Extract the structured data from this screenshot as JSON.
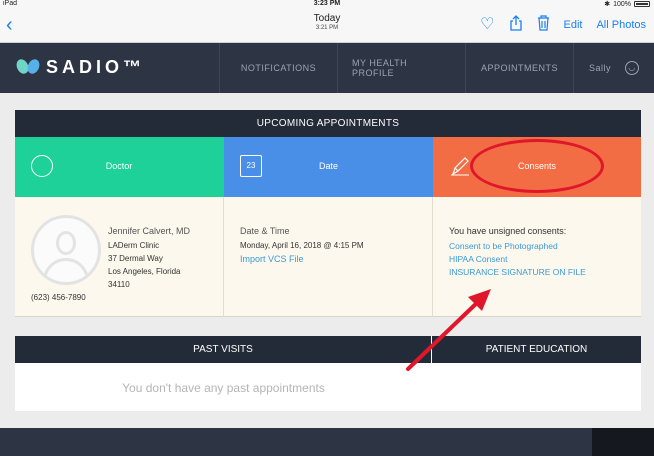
{
  "status_bar": {
    "device": "iPad",
    "time": "3:23 PM",
    "battery": "100%"
  },
  "photo_nav": {
    "title": "Today",
    "subtitle": "3:21 PM",
    "edit_label": "Edit",
    "all_photos_label": "All Photos"
  },
  "app": {
    "logo_text": "SADIO™",
    "nav": {
      "notifications": "NOTIFICATIONS",
      "health_profile": "MY HEALTH PROFILE",
      "appointments": "APPOINTMENTS",
      "user_name": "Sally"
    }
  },
  "upcoming": {
    "title": "UPCOMING APPOINTMENTS",
    "columns": {
      "doctor": "Doctor",
      "date": "Date",
      "consents": "Consents"
    },
    "calendar_day": "23",
    "doctor": {
      "name": "Jennifer Calvert, MD",
      "clinic": "LADerm Clinic",
      "street": "37 Dermal Way",
      "city": "Los Angeles, Florida",
      "zip": "34110",
      "phone": "(623) 456-7890"
    },
    "datetime": {
      "label": "Date & Time",
      "value": "Monday, April 16, 2018 @ 4:15 PM",
      "import_link": "Import VCS File"
    },
    "consents": {
      "title": "You have unsigned consents:",
      "items": [
        "Consent to be Photographed",
        "HIPAA Consent",
        "INSURANCE SIGNATURE ON FILE"
      ]
    }
  },
  "past": {
    "visits_title": "PAST VISITS",
    "education_title": "PATIENT EDUCATION",
    "empty_message": "You don't have any past appointments"
  },
  "colors": {
    "header_bg": "#2d3444",
    "doctor_green": "#1ed198",
    "date_blue": "#4a8fe7",
    "consents_orange": "#f26c44",
    "link_blue": "#3a9ad9",
    "annotation_red": "#e0172a"
  }
}
